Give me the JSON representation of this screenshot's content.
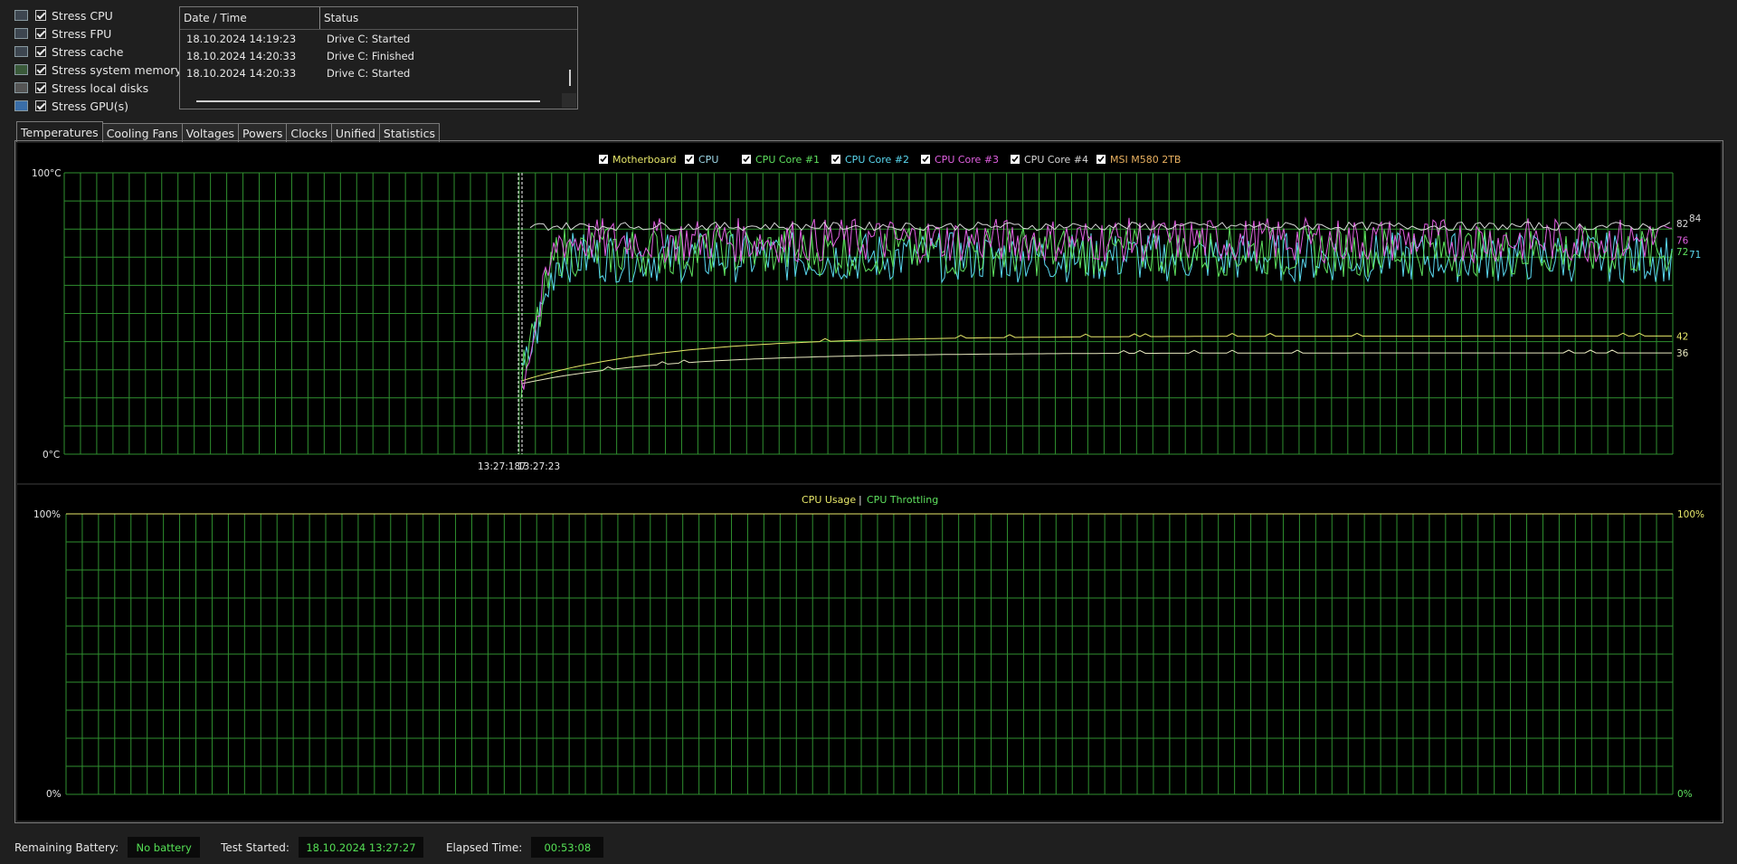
{
  "stress": [
    {
      "label": "Stress CPU",
      "icon": "cpu-icon"
    },
    {
      "label": "Stress FPU",
      "icon": "fpu-icon"
    },
    {
      "label": "Stress cache",
      "icon": "cache-icon"
    },
    {
      "label": "Stress system memory",
      "icon": "memory-icon"
    },
    {
      "label": "Stress local disks",
      "icon": "disk-icon"
    },
    {
      "label": "Stress GPU(s)",
      "icon": "gpu-icon"
    }
  ],
  "log": {
    "headers": [
      "Date / Time",
      "Status"
    ],
    "rows": [
      {
        "time": "18.10.2024 14:19:23",
        "status": "Drive C: Started"
      },
      {
        "time": "18.10.2024 14:20:33",
        "status": "Drive C: Finished"
      },
      {
        "time": "18.10.2024 14:20:33",
        "status": "Drive C: Started"
      }
    ]
  },
  "tabs": [
    "Temperatures",
    "Cooling Fans",
    "Voltages",
    "Powers",
    "Clocks",
    "Unified",
    "Statistics"
  ],
  "temp_chart": {
    "legend": [
      {
        "label": "Motherboard",
        "color": "#e8e86a"
      },
      {
        "label": "CPU",
        "color": "#9fd9e8"
      },
      {
        "label": "CPU Core #1",
        "color": "#5ee05e"
      },
      {
        "label": "CPU Core #2",
        "color": "#5ad8f0"
      },
      {
        "label": "CPU Core #3",
        "color": "#e060e0"
      },
      {
        "label": "CPU Core #4",
        "color": "#d8d8d8"
      },
      {
        "label": "MSI M580 2TB",
        "color": "#e8b060"
      }
    ],
    "y_top": "100°C",
    "y_bottom": "0°C",
    "x_labels": "13:27:23",
    "x_labels_overlap": "13:27:187",
    "end_values": [
      {
        "value": "84",
        "color": "#d8d8d8",
        "y": 84
      },
      {
        "value": "82",
        "color": "#d8d8d8",
        "y": 82
      },
      {
        "value": "76",
        "color": "#e060e0",
        "y": 76
      },
      {
        "value": "72",
        "color": "#5ee05e",
        "y": 72
      },
      {
        "value": "71",
        "color": "#5ad8f0",
        "y": 71
      },
      {
        "value": "42",
        "color": "#e8e86a",
        "y": 42
      },
      {
        "value": "36",
        "color": "#e8e8c0",
        "y": 36
      }
    ]
  },
  "usage_chart": {
    "legend_usage": "CPU Usage",
    "separator": "|",
    "legend_throttle": "CPU Throttling",
    "y_top_left": "100%",
    "y_bottom_left": "0%",
    "y_top_right": "100%",
    "y_bottom_right": "0%",
    "usage_color": "#e8e86a",
    "throttle_color": "#5ee05e"
  },
  "chart_data": [
    {
      "type": "line",
      "ylim": [
        0,
        100
      ],
      "ylabel": "",
      "xlabel": "",
      "series": [
        {
          "name": "Motherboard",
          "end_value": 42
        },
        {
          "name": "MSI M580 2TB",
          "end_value": 36
        },
        {
          "name": "CPU Core #3",
          "end_value": 76
        },
        {
          "name": "CPU Core #1",
          "end_value": 72
        },
        {
          "name": "CPU Core #2",
          "end_value": 71
        },
        {
          "name": "CPU Core #4",
          "end_value": 84
        },
        {
          "name": "CPU",
          "end_value": 82
        }
      ]
    },
    {
      "type": "line",
      "ylim": [
        0,
        100
      ],
      "series": [
        {
          "name": "CPU Usage",
          "values": []
        },
        {
          "name": "CPU Throttling",
          "values": []
        }
      ]
    }
  ],
  "status": {
    "battery_label": "Remaining Battery:",
    "battery_value": "No battery",
    "started_label": "Test Started:",
    "started_value": "18.10.2024 13:27:27",
    "elapsed_label": "Elapsed Time:",
    "elapsed_value": "00:53:08"
  }
}
